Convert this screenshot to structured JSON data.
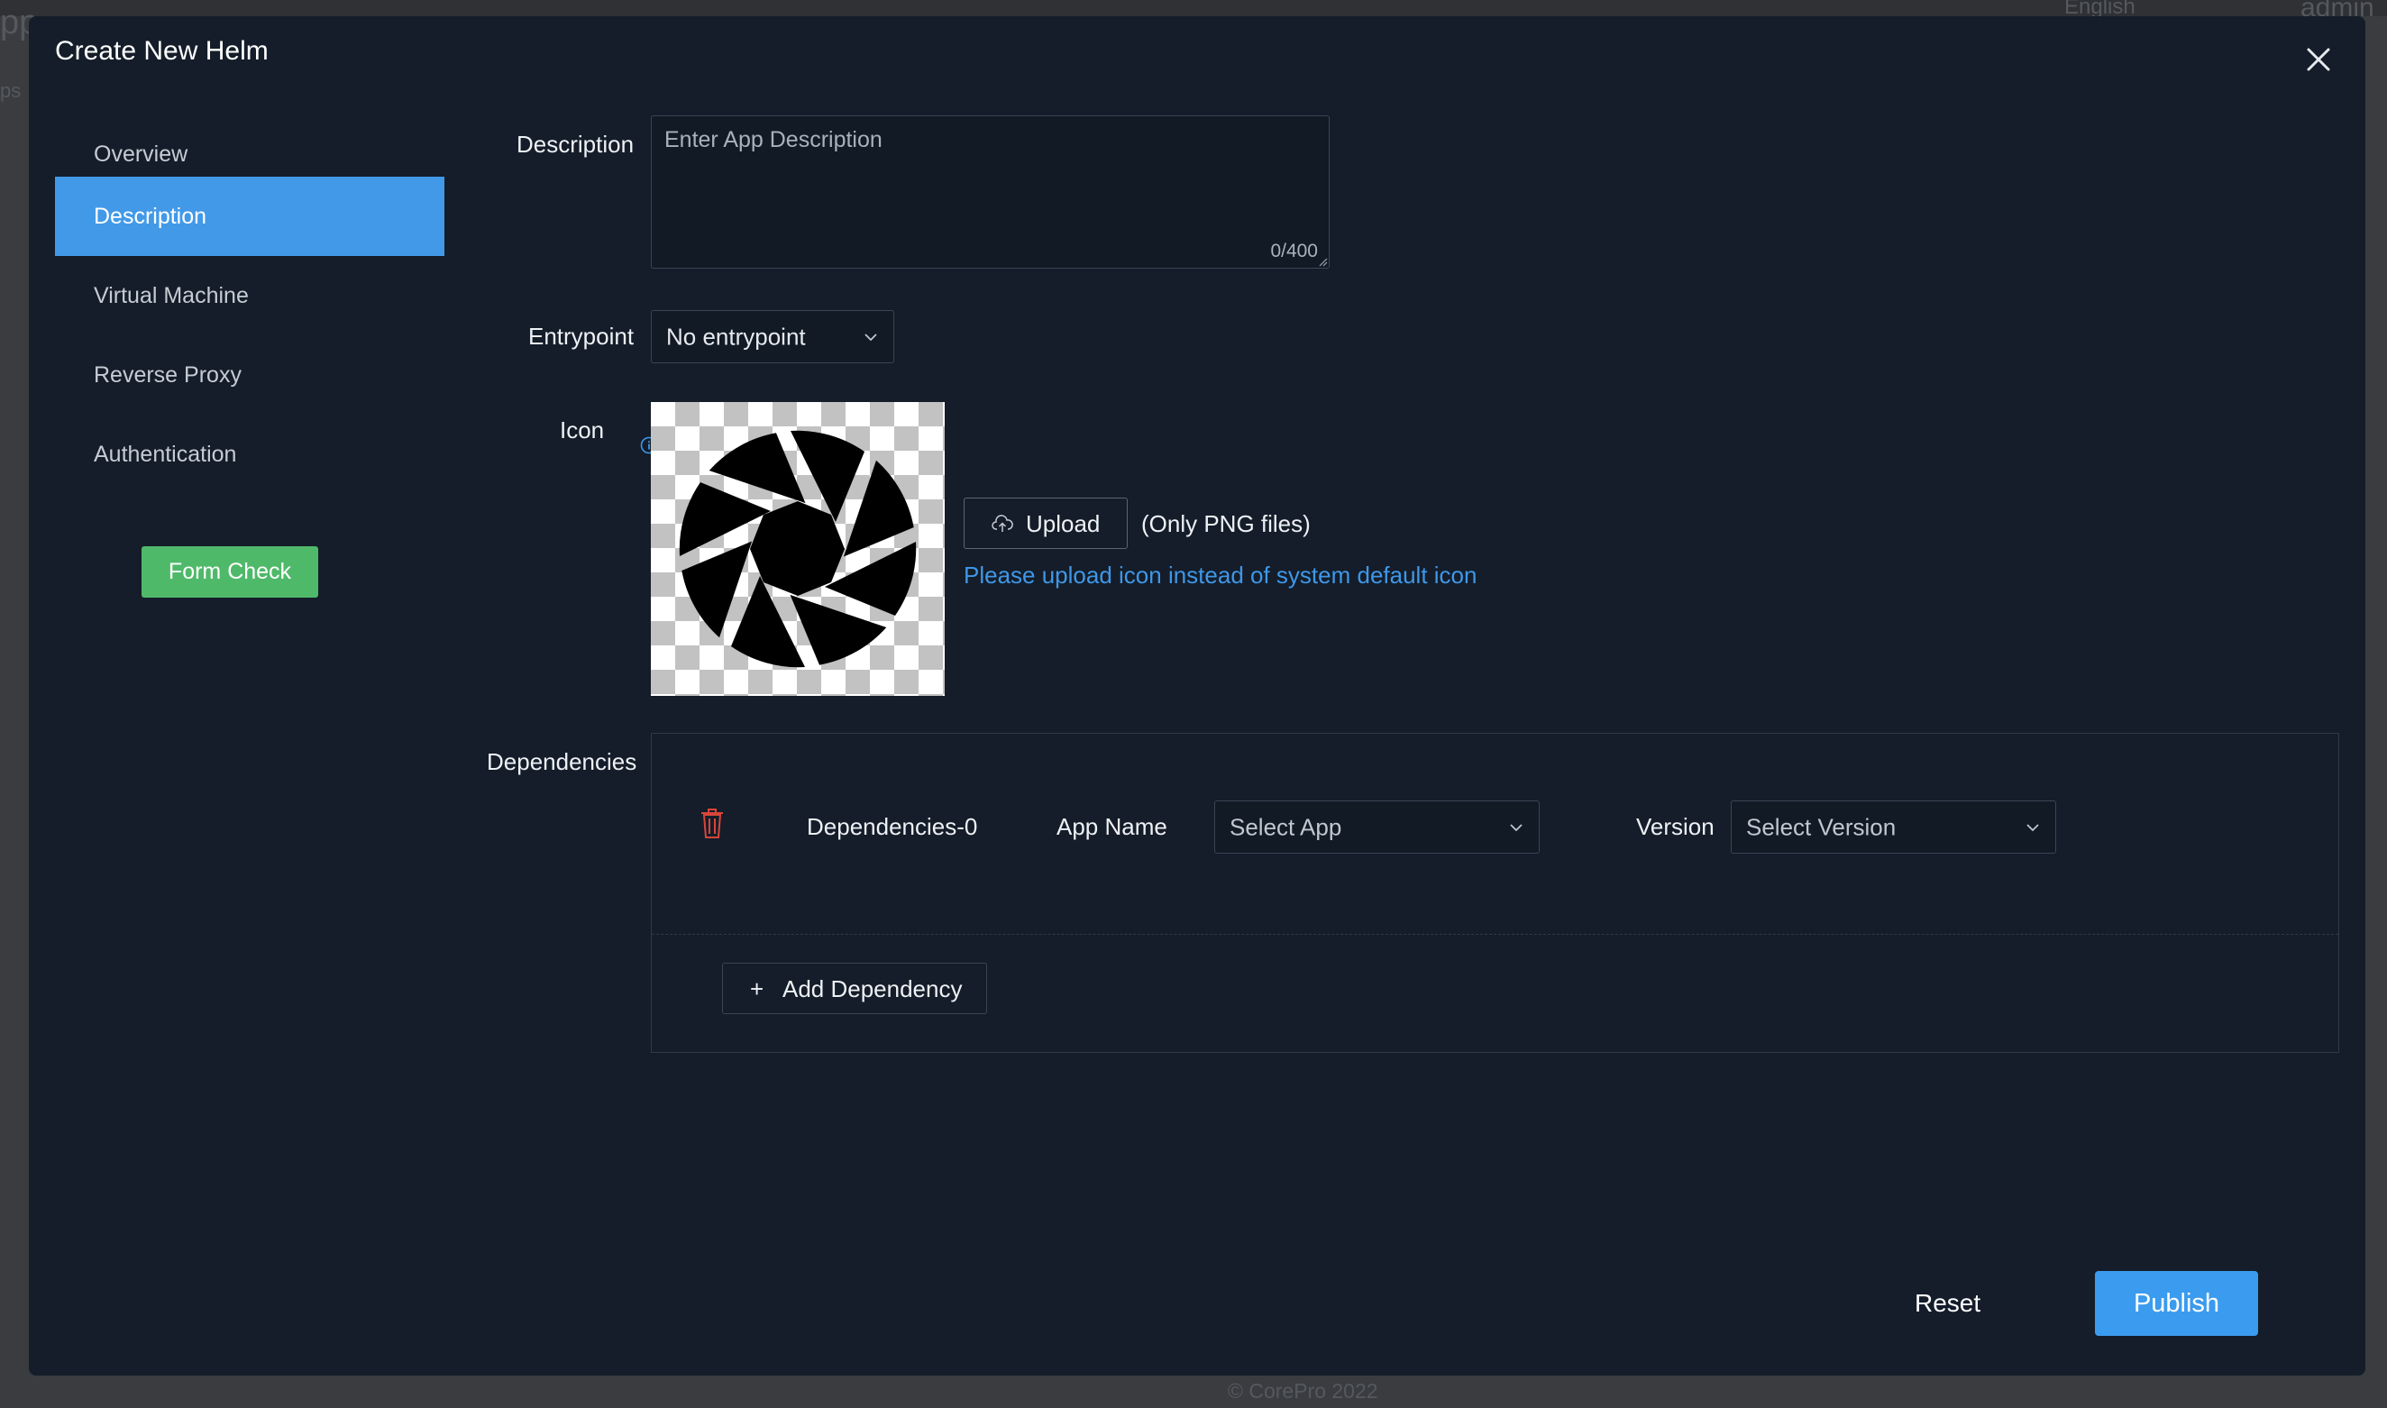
{
  "background": {
    "language": "English",
    "user": "admin",
    "footer": "© CorePro 2022",
    "partial_title": "pp",
    "partial_sub": "ps"
  },
  "modal": {
    "title": "Create New Helm",
    "close_icon": "close-icon"
  },
  "nav": {
    "items": [
      {
        "label": "Overview",
        "active": false
      },
      {
        "label": "Description",
        "active": true
      },
      {
        "label": "Virtual Machine",
        "active": false
      },
      {
        "label": "Reverse Proxy",
        "active": false
      },
      {
        "label": "Authentication",
        "active": false
      }
    ],
    "form_check_label": "Form Check"
  },
  "form": {
    "description": {
      "label": "Description",
      "placeholder": "Enter App Description",
      "value": "",
      "counter": "0/400"
    },
    "entrypoint": {
      "label": "Entrypoint",
      "selected": "No entrypoint"
    },
    "icon": {
      "label": "Icon",
      "info_icon": "info-icon",
      "upload_label": "Upload",
      "upload_icon": "cloud-upload-icon",
      "file_note": "(Only PNG files)",
      "hint": "Please upload icon instead of system default icon"
    },
    "dependencies": {
      "label": "Dependencies",
      "items": [
        {
          "name": "Dependencies-0",
          "app_label": "App Name",
          "app_placeholder": "Select App",
          "version_label": "Version",
          "version_placeholder": "Select Version"
        }
      ],
      "add_label": "Add Dependency"
    }
  },
  "footer_actions": {
    "reset_label": "Reset",
    "publish_label": "Publish"
  },
  "colors": {
    "modal_bg": "#141d29",
    "accent": "#4299e8",
    "form_check": "#4fb96a",
    "danger": "#d9453a",
    "link": "#3f97e8"
  }
}
